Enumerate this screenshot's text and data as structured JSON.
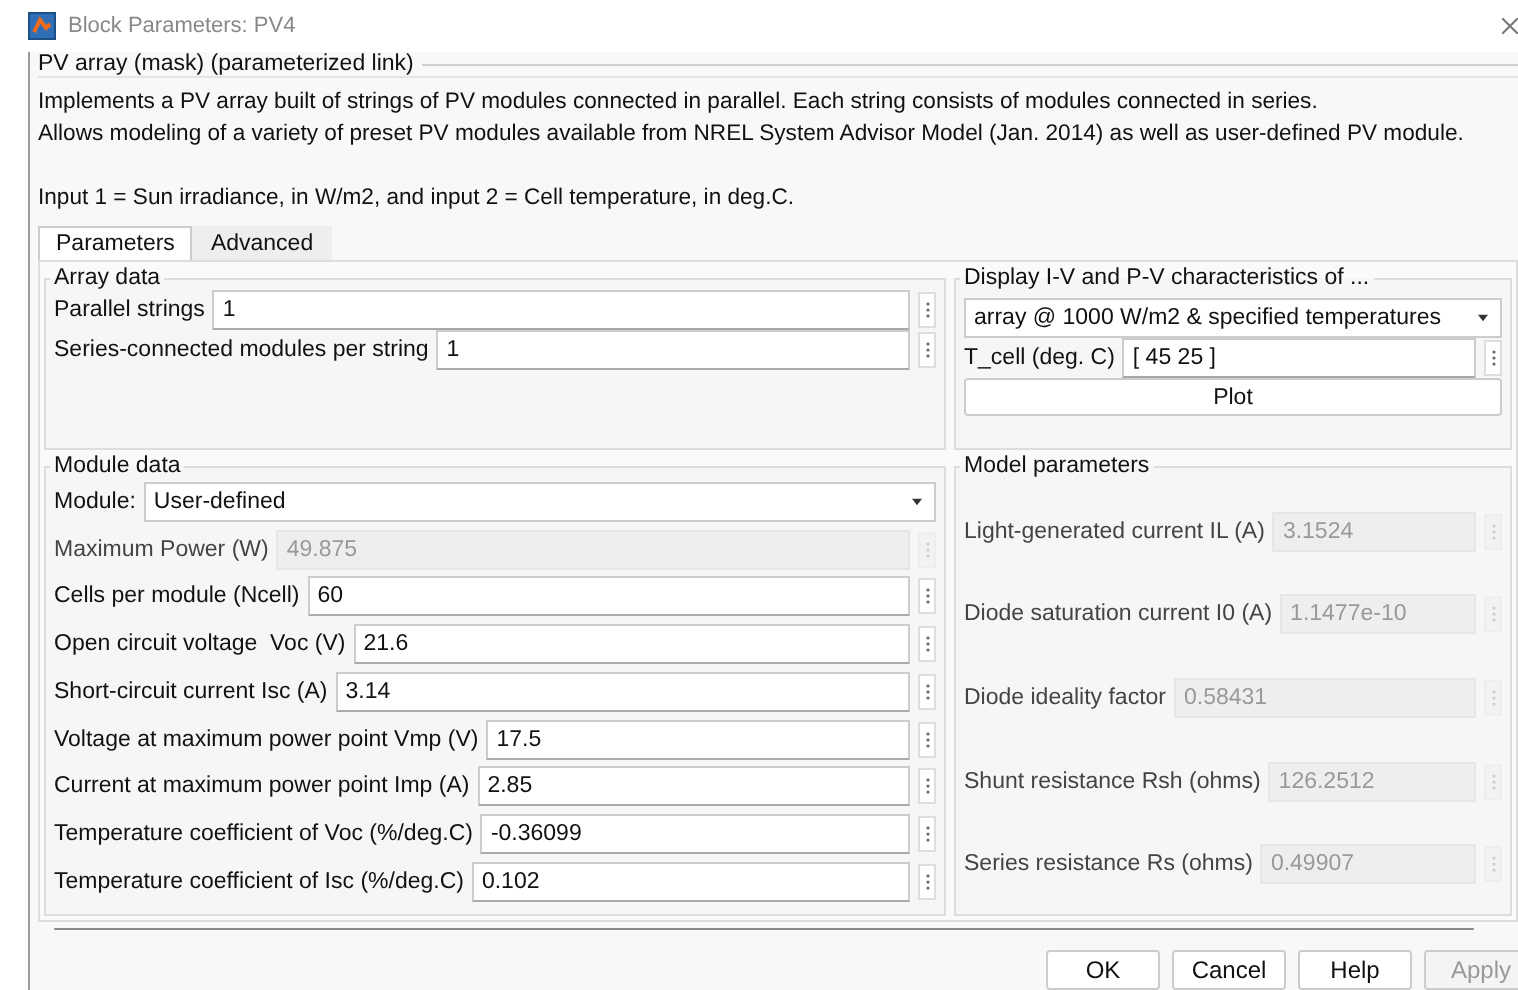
{
  "window": {
    "title": "Block Parameters: PV4"
  },
  "mask_title": "PV array (mask) (parameterized link)",
  "description": [
    "Implements a PV array built of strings of PV modules connected in parallel. Each string consists of modules connected in series.",
    "Allows modeling of a variety of preset PV modules available from NREL System Advisor Model (Jan. 2014) as well as user-defined PV module."
  ],
  "inputs_note": "Input 1 = Sun irradiance, in W/m2, and input 2 = Cell temperature, in deg.C.",
  "tabs": [
    {
      "label": "Parameters",
      "selected": true
    },
    {
      "label": "Advanced",
      "selected": false
    }
  ],
  "array_data": {
    "title": "Array data",
    "fields": [
      {
        "kind": "text",
        "label": "Parallel strings",
        "value": "1",
        "disabled": false
      },
      {
        "kind": "text",
        "label": "Series-connected modules per string",
        "value": "1",
        "disabled": false
      }
    ]
  },
  "module_data": {
    "title": "Module data",
    "fields": [
      {
        "kind": "dropdown",
        "label": "Module:",
        "value": "User-defined",
        "disabled": false
      },
      {
        "kind": "text",
        "label": "Maximum Power (W)",
        "value": "49.875",
        "disabled": true
      },
      {
        "kind": "text",
        "label": "Cells per module (Ncell)",
        "value": "60",
        "disabled": false
      },
      {
        "kind": "text",
        "label": "Open circuit voltage  Voc (V)",
        "value": "21.6",
        "disabled": false
      },
      {
        "kind": "text",
        "label": "Short-circuit current Isc (A)",
        "value": "3.14",
        "disabled": false
      },
      {
        "kind": "text",
        "label": "Voltage at maximum power point Vmp (V)",
        "value": "17.5",
        "disabled": false
      },
      {
        "kind": "text",
        "label": "Current at maximum power point Imp (A)",
        "value": "2.85",
        "disabled": false
      },
      {
        "kind": "text",
        "label": "Temperature coefficient of Voc (%/deg.C)",
        "value": "-0.36099",
        "disabled": false
      },
      {
        "kind": "text",
        "label": "Temperature coefficient of Isc (%/deg.C)",
        "value": "0.102",
        "disabled": false
      }
    ]
  },
  "display": {
    "title": "Display  I-V and P-V characteristics of ...",
    "fields": [
      {
        "kind": "dropdown",
        "value": "array @ 1000 W/m2 & specified temperatures",
        "disabled": false
      },
      {
        "kind": "text",
        "label": "T_cell (deg. C)",
        "value": "[ 45 25 ]",
        "disabled": false
      },
      {
        "kind": "button",
        "value": "Plot",
        "disabled": false
      }
    ]
  },
  "model_parameters": {
    "title": "Model parameters",
    "fields": [
      {
        "kind": "text",
        "label": "Light-generated current IL (A)",
        "value": "3.1524",
        "disabled": true
      },
      {
        "kind": "text",
        "label": "Diode saturation current I0 (A)",
        "value": "1.1477e-10",
        "disabled": true
      },
      {
        "kind": "text",
        "label": "Diode ideality factor",
        "value": "0.58431",
        "disabled": true
      },
      {
        "kind": "text",
        "label": "Shunt resistance Rsh (ohms)",
        "value": "126.2512",
        "disabled": true
      },
      {
        "kind": "text",
        "label": "Series resistance Rs (ohms)",
        "value": "0.49907",
        "disabled": true
      }
    ]
  },
  "buttons": [
    {
      "label": "OK",
      "disabled": false
    },
    {
      "label": "Cancel",
      "disabled": false
    },
    {
      "label": "Help",
      "disabled": false
    },
    {
      "label": "Apply",
      "disabled": true
    }
  ]
}
